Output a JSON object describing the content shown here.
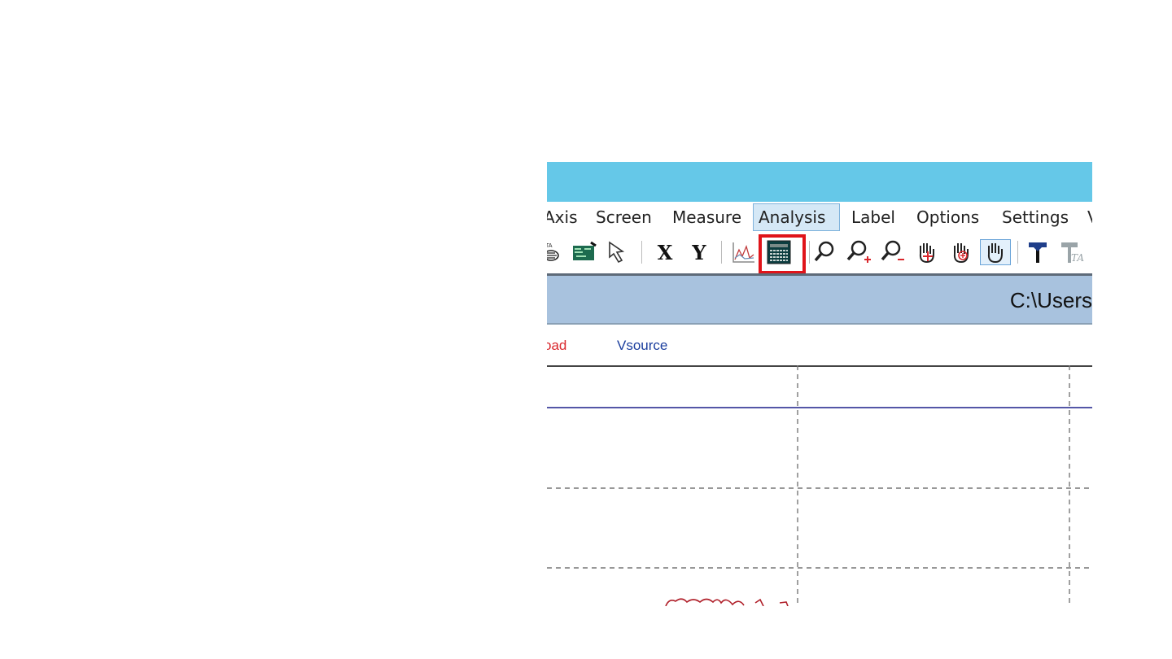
{
  "menu": {
    "items": [
      "Axis",
      "Screen",
      "Measure",
      "Analysis",
      "Label",
      "Options",
      "Settings",
      "V"
    ],
    "active": "Analysis"
  },
  "toolbar": {
    "x_label": "X",
    "y_label": "Y",
    "highlight_color": "#e0141a",
    "icons": [
      "data-icon",
      "chip-icon",
      "pointer-arrow-icon",
      "x-axis-button",
      "y-axis-button",
      "graph-icon",
      "table-icon",
      "zoom-icon",
      "zoom-in-icon",
      "zoom-out-icon",
      "pan-hand-icon",
      "pan-hand-plus-icon",
      "hand-icon",
      "tag-icon",
      "text-tag-icon"
    ]
  },
  "path": {
    "text": "C:\\Users"
  },
  "legend": {
    "items": [
      {
        "label": "oad",
        "color": "#d9262b"
      },
      {
        "label": "Vsource",
        "color": "#1c3f9e"
      }
    ]
  },
  "colors": {
    "titlebar": "#65c8e8",
    "pathbar": "#a8c2de",
    "trace_blue": "#1b1f8a",
    "trace_red": "#b0202a"
  }
}
